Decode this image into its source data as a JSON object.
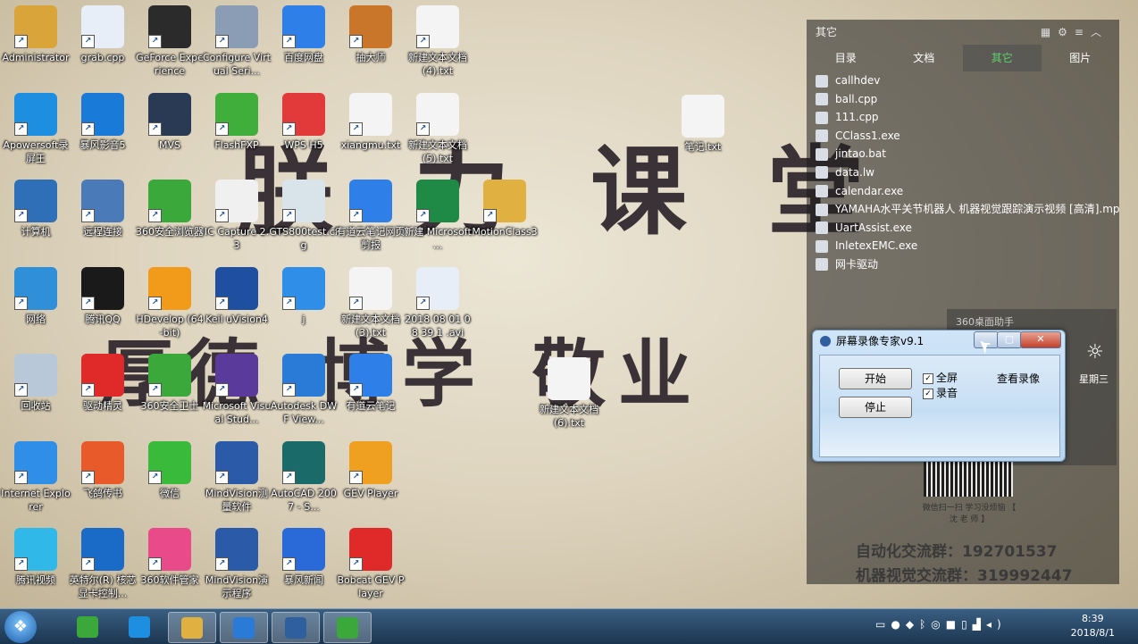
{
  "wallpaper": {
    "title_line_1": [
      "朕",
      "力",
      "课",
      "堂"
    ],
    "title_line_2": [
      "厚德",
      "博学",
      "敬业"
    ]
  },
  "desktop_icons": [
    {
      "label": "Administrator",
      "color": "#d9a53a",
      "icon": "user-folder-icon",
      "col": 0,
      "row": 0
    },
    {
      "label": "grab.cpp",
      "color": "#e8eef8",
      "icon": "cpp-file-icon",
      "col": 1,
      "row": 0
    },
    {
      "label": "GeForce Experience",
      "color": "#2b2b2b",
      "icon": "nvidia-icon",
      "col": 2,
      "row": 0
    },
    {
      "label": "Configure Virtual Seri...",
      "color": "#8a9db5",
      "icon": "serial-port-icon",
      "col": 3,
      "row": 0
    },
    {
      "label": "百度网盘",
      "color": "#2f7fe8",
      "icon": "cloud-disk-icon",
      "col": 4,
      "row": 0
    },
    {
      "label": "抽大师",
      "color": "#c9762a",
      "icon": "sweep-icon",
      "col": 5,
      "row": 0
    },
    {
      "label": "新建文本文档(4).txt",
      "color": "#f4f4f4",
      "icon": "text-file-icon",
      "col": 6,
      "row": 0
    },
    {
      "label": "Apowersoft录屏王",
      "color": "#1e8fe0",
      "icon": "camera-icon",
      "col": 0,
      "row": 1
    },
    {
      "label": "暴风影音5",
      "color": "#1a7ad8",
      "icon": "media-player-icon",
      "col": 1,
      "row": 1
    },
    {
      "label": "MVS",
      "color": "#2a3a55",
      "icon": "camera-lens-icon",
      "col": 2,
      "row": 1
    },
    {
      "label": "FlashFXP",
      "color": "#3fae3a",
      "icon": "ftp-icon",
      "col": 3,
      "row": 1
    },
    {
      "label": "WPS H5",
      "color": "#e23a3a",
      "icon": "wps-icon",
      "col": 4,
      "row": 1
    },
    {
      "label": "xiangmu.txt",
      "color": "#f4f4f4",
      "icon": "text-file-icon",
      "col": 5,
      "row": 1
    },
    {
      "label": "新建文本文档(5).txt",
      "color": "#f4f4f4",
      "icon": "text-file-icon",
      "col": 6,
      "row": 1
    },
    {
      "label": "计算机",
      "color": "#2f6fb8",
      "icon": "computer-icon",
      "col": 0,
      "row": 2
    },
    {
      "label": "远程连接",
      "color": "#4a7ab8",
      "icon": "remote-desktop-icon",
      "col": 1,
      "row": 2
    },
    {
      "label": "360安全浏览器",
      "color": "#3aa83a",
      "icon": "browser-icon",
      "col": 2,
      "row": 2
    },
    {
      "label": "IC Capture 2.3",
      "color": "#f0f0f0",
      "icon": "ic-capture-icon",
      "col": 3,
      "row": 2
    },
    {
      "label": "GTS800test.cfg",
      "color": "#d8e4ea",
      "icon": "config-file-icon",
      "col": 4,
      "row": 2
    },
    {
      "label": "有道云笔记网页剪报",
      "color": "#2f7fe8",
      "icon": "web-clip-icon",
      "col": 5,
      "row": 2
    },
    {
      "label": "新建 Microsoft ...",
      "color": "#1f8a45",
      "icon": "excel-file-icon",
      "col": 6,
      "row": 2
    },
    {
      "label": "MotionClass3",
      "color": "#e0b040",
      "icon": "folder-icon",
      "col": 7,
      "row": 2
    },
    {
      "label": "网络",
      "color": "#2f8fd8",
      "icon": "network-icon",
      "col": 0,
      "row": 3
    },
    {
      "label": "腾讯QQ",
      "color": "#1a1a1a",
      "icon": "qq-icon",
      "col": 1,
      "row": 3
    },
    {
      "label": "HDevelop (64-bit)",
      "color": "#f29a1a",
      "icon": "halcon-icon",
      "col": 2,
      "row": 3
    },
    {
      "label": "Keil uVision4",
      "color": "#1e4fa0",
      "icon": "keil-icon",
      "col": 3,
      "row": 3
    },
    {
      "label": "j",
      "color": "#2f8fe8",
      "icon": "app-icon",
      "col": 4,
      "row": 3
    },
    {
      "label": "新建文本文档(3).txt",
      "color": "#f4f4f4",
      "icon": "text-file-icon",
      "col": 5,
      "row": 3
    },
    {
      "label": "2018 08 01 08 39 1 .avi",
      "color": "#e8eef8",
      "icon": "avi-file-icon",
      "col": 6,
      "row": 3
    },
    {
      "label": "回收站",
      "color": "#b8c8d8",
      "icon": "recycle-bin-icon",
      "col": 0,
      "row": 4
    },
    {
      "label": "驱动精灵",
      "color": "#e02a2a",
      "icon": "driver-icon",
      "col": 1,
      "row": 4
    },
    {
      "label": "360安全卫士",
      "color": "#3aa83a",
      "icon": "shield-icon",
      "col": 2,
      "row": 4
    },
    {
      "label": "Microsoft Visual Stud...",
      "color": "#5a3a9a",
      "icon": "visual-studio-icon",
      "col": 3,
      "row": 4
    },
    {
      "label": "Autodesk DWF View...",
      "color": "#2a7ad8",
      "icon": "globe-icon",
      "col": 4,
      "row": 4
    },
    {
      "label": "有道云笔记",
      "color": "#2f7fe8",
      "icon": "note-icon",
      "col": 5,
      "row": 4
    },
    {
      "label": "Internet Explorer",
      "color": "#2f8fe8",
      "icon": "ie-icon",
      "col": 0,
      "row": 5
    },
    {
      "label": "飞鸽传书",
      "color": "#e85a2a",
      "icon": "messenger-icon",
      "col": 1,
      "row": 5
    },
    {
      "label": "微信",
      "color": "#3aba3a",
      "icon": "wechat-icon",
      "col": 2,
      "row": 5
    },
    {
      "label": "MindVision测量软件",
      "color": "#2a5aa8",
      "icon": "measure-icon",
      "col": 3,
      "row": 5
    },
    {
      "label": "AutoCAD 2007 - S...",
      "color": "#1a6a6a",
      "icon": "autocad-icon",
      "col": 4,
      "row": 5
    },
    {
      "label": "GEV Player",
      "color": "#f0a020",
      "icon": "gev-icon",
      "col": 5,
      "row": 5
    },
    {
      "label": "腾讯视频",
      "color": "#2fb8e8",
      "icon": "video-icon",
      "col": 0,
      "row": 6
    },
    {
      "label": "英特尔(R) 核芯显卡控制...",
      "color": "#1a6ac8",
      "icon": "intel-icon",
      "col": 1,
      "row": 6
    },
    {
      "label": "360软件管家",
      "color": "#e84a8a",
      "icon": "software-manager-icon",
      "col": 2,
      "row": 6
    },
    {
      "label": "MindVision演示程序",
      "color": "#2a5aa8",
      "icon": "demo-icon",
      "col": 3,
      "row": 6
    },
    {
      "label": "暴风新闻",
      "color": "#2a6ad8",
      "icon": "news-icon",
      "col": 4,
      "row": 6
    },
    {
      "label": "Bobcat GEV Player",
      "color": "#e02a2a",
      "icon": "bobcat-icon",
      "col": 5,
      "row": 6
    }
  ],
  "txt_on_right": {
    "label": "笔记.txt"
  },
  "txt_lower": {
    "label": "新建文本文档(6).txt"
  },
  "file_panel": {
    "title": "其它",
    "tabs": [
      "目录",
      "文档",
      "其它",
      "图片"
    ],
    "files": [
      "callhdev",
      "ball.cpp",
      "111.cpp",
      "CClass1.exe",
      "jintao.bat",
      "data.lw",
      "calendar.exe",
      "YAMAHA水平关节机器人 机器视觉跟踪演示视频 [高清].mp4",
      "UartAssist.exe",
      "InletexEMC.exe",
      "网卡驱动"
    ]
  },
  "widget": {
    "title": "360桌面助手",
    "weekday": "星期三"
  },
  "dialog": {
    "title": "屏幕录像专家v9.1",
    "start_label": "开始",
    "stop_label": "停止",
    "fullscreen_label": "全屏",
    "audio_label": "录音",
    "view_label": "查看录像"
  },
  "promo": {
    "qr_caption": "微信扫一扫 学习没烦恼 【 沈 老 师 】",
    "group_1": "自动化交流群：192701537",
    "group_2": "机器视觉交流群：319992447"
  },
  "taskbar": {
    "time": "8:39",
    "date": "2018/8/1",
    "items": [
      {
        "icon": "browser-360-icon",
        "color": "#3aa83a"
      },
      {
        "icon": "camera-icon",
        "color": "#1e8fe0"
      },
      {
        "icon": "explorer-folder-icon",
        "color": "#e0b040"
      },
      {
        "icon": "wps-writer-icon",
        "color": "#2a7ad8"
      },
      {
        "icon": "screen-recorder-icon",
        "color": "#2f5f9e"
      },
      {
        "icon": "app-green-icon",
        "color": "#3aa83a"
      }
    ]
  }
}
